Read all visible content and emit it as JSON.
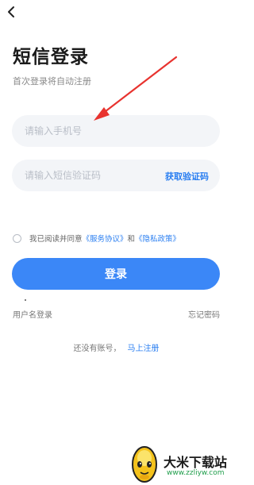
{
  "nav": {
    "back_icon": "chevron-left-icon"
  },
  "header": {
    "title": "短信登录",
    "subtitle": "首次登录将自动注册"
  },
  "form": {
    "phone_placeholder": "请输入手机号",
    "phone_value": "",
    "code_placeholder": "请输入短信验证码",
    "code_value": "",
    "get_code_label": "获取验证码"
  },
  "agreement": {
    "prefix": "我已阅读并同意",
    "service_link": "《服务协议》",
    "conjunction": "和",
    "privacy_link": "《隐私政策》",
    "checked": false
  },
  "actions": {
    "login_label": "登录",
    "username_login_label": "用户名登录",
    "forgot_password_label": "忘记密码",
    "no_account_text": "还没有账号，",
    "register_label": "马上注册"
  },
  "watermark": {
    "name": "大米下载站",
    "url": "www.zzliyw.com"
  },
  "colors": {
    "accent": "#3b87f7",
    "link": "#2b7ff1",
    "field_bg": "#f3f5f8",
    "arrow": "#e8332f"
  }
}
